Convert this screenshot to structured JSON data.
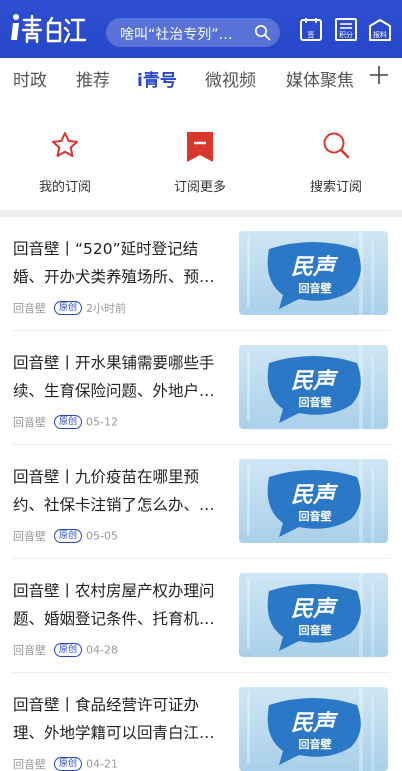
{
  "header": {
    "logo_text": "i青白江",
    "search_placeholder": "啥叫“社治专列”…",
    "icons": [
      {
        "name": "sign-in-icon",
        "label": "签"
      },
      {
        "name": "points-icon",
        "label": "积分"
      },
      {
        "name": "report-icon",
        "label": "报料"
      }
    ]
  },
  "tabs": [
    {
      "label": "时政",
      "active": false
    },
    {
      "label": "推荐",
      "active": false
    },
    {
      "label": "i青号",
      "active": true
    },
    {
      "label": "微视频",
      "active": false
    },
    {
      "label": "媒体聚焦",
      "active": false
    }
  ],
  "actions": [
    {
      "label": "我的订阅",
      "icon": "star-icon"
    },
    {
      "label": "订阅更多",
      "icon": "bookmark-icon"
    },
    {
      "label": "搜索订阅",
      "icon": "search-icon"
    }
  ],
  "thumbnail": {
    "line1": "民声",
    "line2": "回音壁"
  },
  "feed": [
    {
      "title": "回音壁丨“520”延时登记结婚、开办犬类养殖场所、预…",
      "source": "回音壁",
      "badge": "原创",
      "time": "2小时前"
    },
    {
      "title": "回音壁丨开水果铺需要哪些手续、生育保险问题、外地户…",
      "source": "回音壁",
      "badge": "原创",
      "time": "05-12"
    },
    {
      "title": "回音壁丨九价疫苗在哪里预约、社保卡注销了怎么办、…",
      "source": "回音壁",
      "badge": "原创",
      "time": "05-05"
    },
    {
      "title": "回音壁丨农村房屋产权办理问题、婚姻登记条件、托育机…",
      "source": "回音壁",
      "badge": "原创",
      "time": "04-28"
    },
    {
      "title": "回音壁丨食品经营许可证办理、外地学籍可以回青白江…",
      "source": "回音壁",
      "badge": "原创",
      "time": "04-21"
    }
  ],
  "colors": {
    "brand": "#2647c9",
    "accent_red": "#d9362c"
  }
}
